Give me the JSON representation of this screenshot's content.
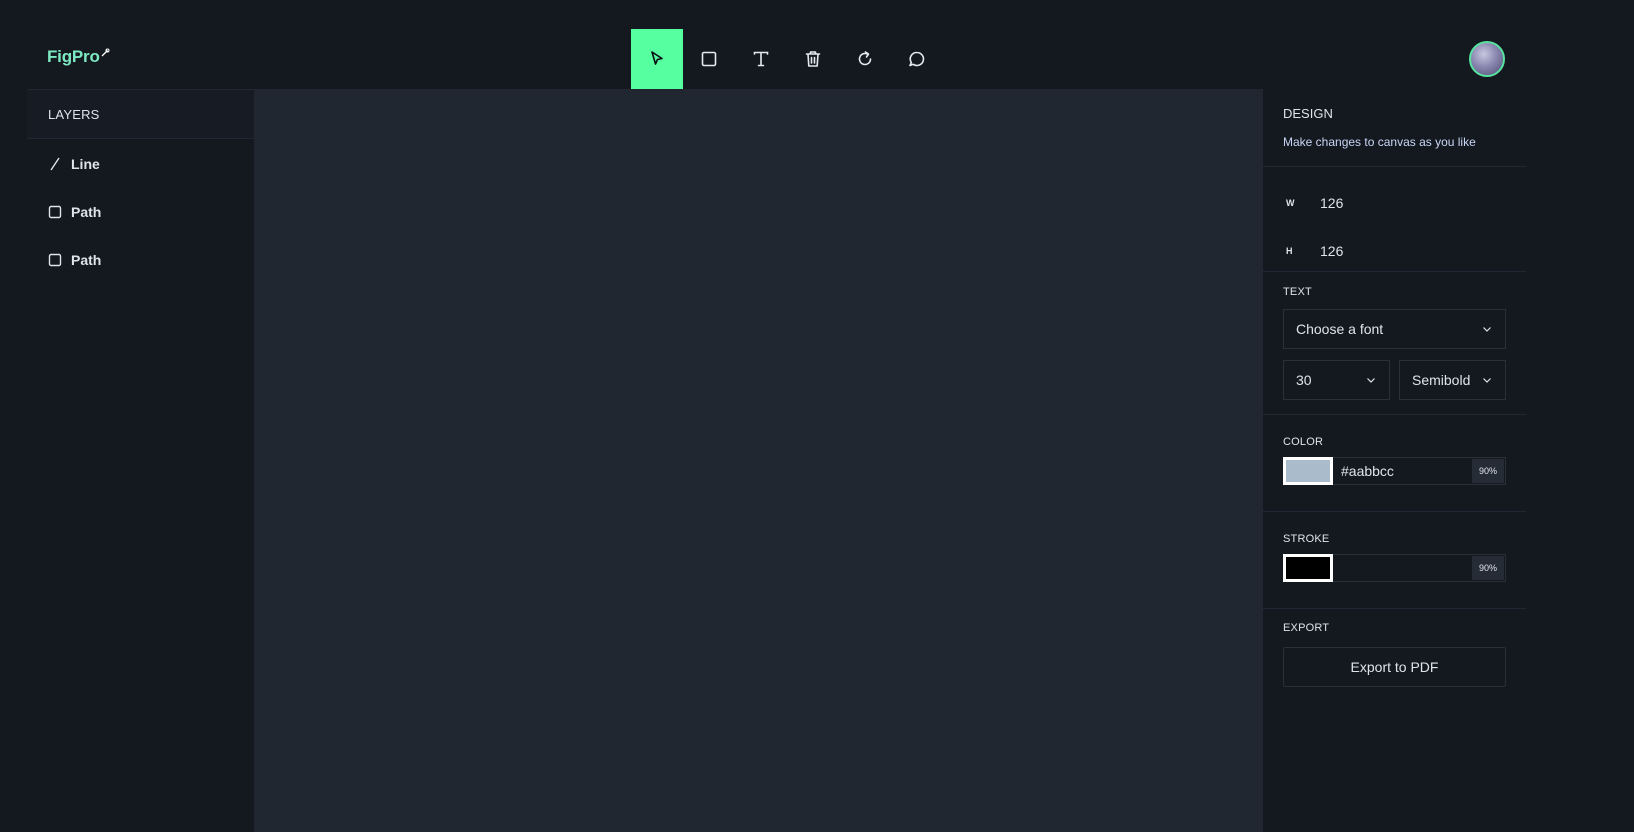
{
  "app": {
    "logo_text": "FigPro"
  },
  "toolbar": {
    "tools": [
      {
        "name": "select",
        "icon": "cursor-icon",
        "active": true
      },
      {
        "name": "rectangle",
        "icon": "square-icon"
      },
      {
        "name": "text",
        "icon": "text-icon"
      },
      {
        "name": "delete",
        "icon": "trash-icon"
      },
      {
        "name": "reset",
        "icon": "refresh-icon"
      },
      {
        "name": "comment",
        "icon": "chat-bubble-icon"
      }
    ],
    "active_color": "#56ff9f"
  },
  "layers": {
    "title": "LAYERS",
    "items": [
      {
        "label": "Line",
        "icon": "line-icon"
      },
      {
        "label": "Path",
        "icon": "square-icon"
      },
      {
        "label": "Path",
        "icon": "square-icon"
      }
    ]
  },
  "design": {
    "title": "DESIGN",
    "subtitle": "Make changes to canvas as you like",
    "width_label": "W",
    "width_value": "126",
    "height_label": "H",
    "height_value": "126",
    "text": {
      "title": "TEXT",
      "font_placeholder": "Choose a font",
      "font_size": "30",
      "font_weight": "Semibold"
    },
    "color": {
      "title": "COLOR",
      "swatch": "#aabbcc",
      "hex": "#aabbcc",
      "opacity": "90%"
    },
    "stroke": {
      "title": "STROKE",
      "swatch": "#000000",
      "hex": "",
      "opacity": "90%"
    },
    "export": {
      "title": "EXPORT",
      "button_label": "Export to PDF"
    }
  },
  "colors": {
    "background": "#14181f",
    "canvas": "#202731",
    "accent": "#56ff9f",
    "logo": "#7de9c2"
  }
}
